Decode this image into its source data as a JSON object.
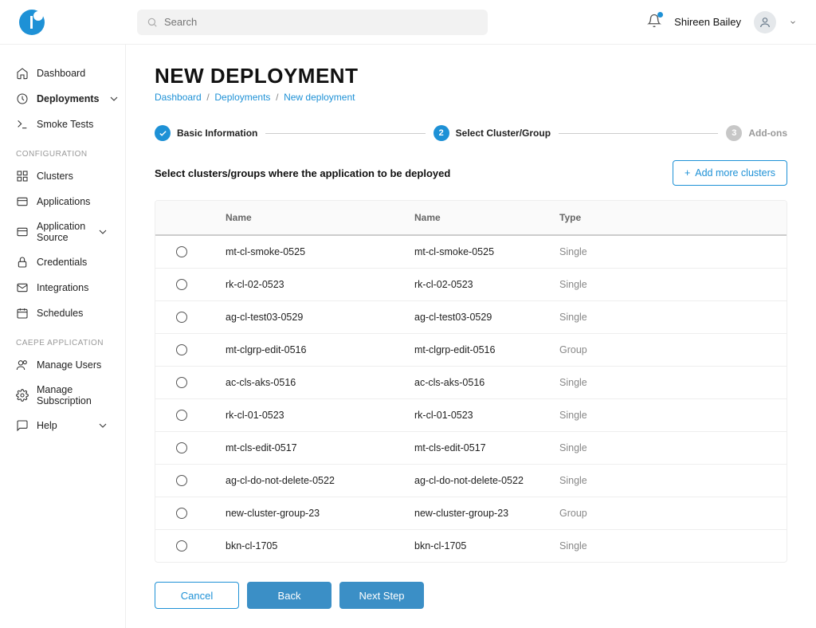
{
  "topbar": {
    "search_placeholder": "Search",
    "username": "Shireen Bailey"
  },
  "sidebar": {
    "items": [
      {
        "label": "Dashboard"
      },
      {
        "label": "Deployments"
      },
      {
        "label": "Smoke Tests"
      }
    ],
    "section_config": "CONFIGURATION",
    "config_items": [
      {
        "label": "Clusters"
      },
      {
        "label": "Applications"
      },
      {
        "label": "Application Source"
      },
      {
        "label": "Credentials"
      },
      {
        "label": "Integrations"
      },
      {
        "label": "Schedules"
      }
    ],
    "section_app": "CAEPE APPLICATION",
    "app_items": [
      {
        "label": "Manage Users"
      },
      {
        "label": "Manage Subscription"
      },
      {
        "label": "Help"
      }
    ]
  },
  "page": {
    "title": "NEW DEPLOYMENT",
    "breadcrumb": {
      "a": "Dashboard",
      "b": "Deployments",
      "c": "New deployment"
    },
    "steps": {
      "s1": "Basic Information",
      "s2": "Select Cluster/Group",
      "s3": "Add-ons",
      "n2": "2",
      "n3": "3"
    },
    "section_title": "Select clusters/groups where the application to be deployed",
    "add_more": "Add more clusters",
    "cols": {
      "name1": "Name",
      "name2": "Name",
      "type": "Type"
    },
    "rows": [
      {
        "n1": "mt-cl-smoke-0525",
        "n2": "mt-cl-smoke-0525",
        "t": "Single"
      },
      {
        "n1": "rk-cl-02-0523",
        "n2": "rk-cl-02-0523",
        "t": "Single"
      },
      {
        "n1": "ag-cl-test03-0529",
        "n2": "ag-cl-test03-0529",
        "t": "Single"
      },
      {
        "n1": "mt-clgrp-edit-0516",
        "n2": "mt-clgrp-edit-0516",
        "t": "Group"
      },
      {
        "n1": "ac-cls-aks-0516",
        "n2": "ac-cls-aks-0516",
        "t": "Single"
      },
      {
        "n1": "rk-cl-01-0523",
        "n2": "rk-cl-01-0523",
        "t": "Single"
      },
      {
        "n1": "mt-cls-edit-0517",
        "n2": "mt-cls-edit-0517",
        "t": "Single"
      },
      {
        "n1": "ag-cl-do-not-delete-0522",
        "n2": "ag-cl-do-not-delete-0522",
        "t": "Single"
      },
      {
        "n1": "new-cluster-group-23",
        "n2": "new-cluster-group-23",
        "t": "Group"
      },
      {
        "n1": "bkn-cl-1705",
        "n2": "bkn-cl-1705",
        "t": "Single"
      }
    ],
    "buttons": {
      "cancel": "Cancel",
      "back": "Back",
      "next": "Next Step"
    }
  }
}
